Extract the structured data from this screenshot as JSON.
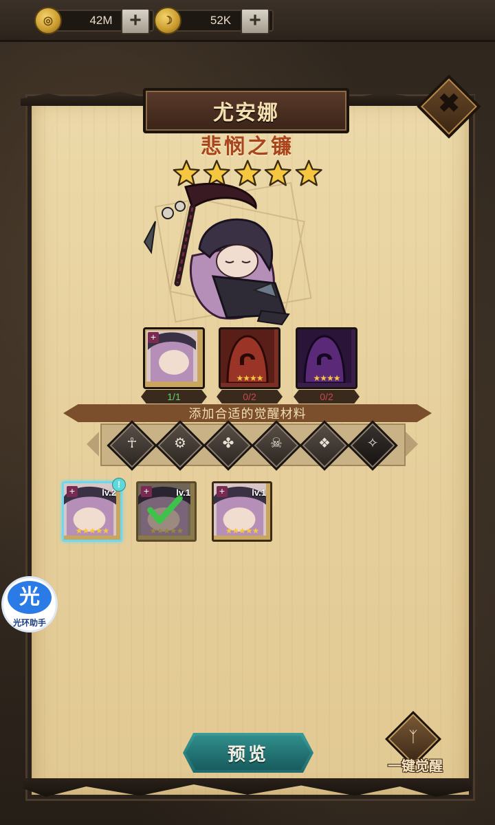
{
  "currencies": [
    {
      "icon": "gold-coin-icon",
      "value": "42M"
    },
    {
      "icon": "gem-coin-icon",
      "value": "52K"
    }
  ],
  "hero": {
    "name": "尤安娜",
    "title": "悲悯之镰",
    "stars": 5
  },
  "materials": [
    {
      "count": "1/1",
      "fulfilled": true
    },
    {
      "count": "0/2",
      "fulfilled": false
    },
    {
      "count": "0/2",
      "fulfilled": false
    }
  ],
  "banner_text": "添加合适的觉醒材料",
  "filter_icons": [
    "ankh-icon",
    "gear-faction-icon",
    "clover-icon",
    "skull-helm-icon",
    "winged-crest-icon",
    "dark-sigil-icon"
  ],
  "candidates": [
    {
      "level": "lv.2",
      "selected": true,
      "checked": false
    },
    {
      "level": "lv.1",
      "selected": false,
      "checked": true
    },
    {
      "level": "lv.1",
      "selected": false,
      "checked": false
    }
  ],
  "helper": {
    "glyph": "光",
    "label": "光环助手"
  },
  "preview_label": "预览",
  "awaken_all_label": "一键觉醒",
  "colors": {
    "accent_teal": "#2f8d8b",
    "title_red": "#a9441f",
    "star_gold": "#f5c740",
    "parchment": "#e7d19e"
  }
}
